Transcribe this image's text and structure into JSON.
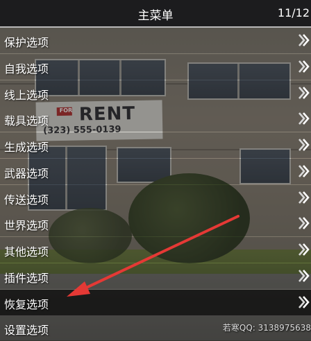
{
  "header": {
    "title": "主菜单",
    "counter": "11/12"
  },
  "items": [
    {
      "label": "保护选项"
    },
    {
      "label": "自我选项"
    },
    {
      "label": "线上选项"
    },
    {
      "label": "载具选项"
    },
    {
      "label": "生成选项"
    },
    {
      "label": "武器选项"
    },
    {
      "label": "传送选项"
    },
    {
      "label": "世界选项"
    },
    {
      "label": "其他选项"
    },
    {
      "label": "插件选项"
    },
    {
      "label": "恢复选项"
    },
    {
      "label": "设置选项"
    }
  ],
  "selected_index": 10,
  "footer_text": "若寒QQ: 3138975638",
  "background_sign": {
    "line1": "RENT",
    "small": "FOR",
    "phone": "(323) 555-0139"
  },
  "colors": {
    "header_bg": "#1c1c1e",
    "selected_bg": "#0a0a0a",
    "text": "#ffffff",
    "annotation_arrow": "#e53935"
  },
  "icons": {
    "item_arrow": "double-chevron-right-icon"
  }
}
